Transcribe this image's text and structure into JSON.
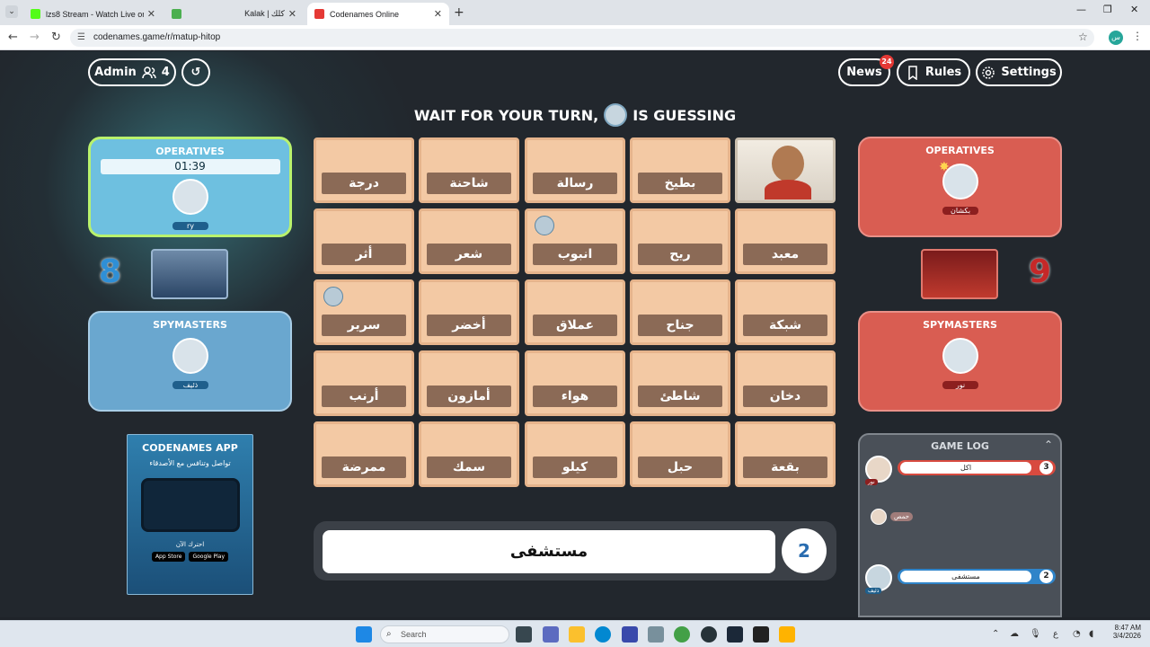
{
  "browser": {
    "tabs": [
      {
        "title": "lzs8 Stream - Watch Live on Kic",
        "favicon_color": "#53fc18"
      },
      {
        "title": "Kalak | كلك",
        "favicon_color": "#4caf50"
      },
      {
        "title": "Codenames Online",
        "favicon_color": "#e53935"
      }
    ],
    "url": "codenames.game/r/matup-hitop",
    "profile_initial": "س"
  },
  "header": {
    "admin_label": "Admin",
    "players_count": "4",
    "news_label": "News",
    "news_badge": "24",
    "rules_label": "Rules",
    "settings_label": "Settings"
  },
  "status": {
    "prefix": "WAIT FOR YOUR TURN,",
    "suffix": "IS GUESSING"
  },
  "blue_team": {
    "operatives_title": "OPERATIVES",
    "timer": "01:39",
    "operative_name": "ry",
    "score": "8",
    "spymasters_title": "SPYMASTERS",
    "spymaster_name": "ذئيف"
  },
  "red_team": {
    "operatives_title": "OPERATIVES",
    "operative_name": "بكشان",
    "score": "9",
    "spymasters_title": "SPYMASTERS",
    "spymaster_name": "نور"
  },
  "app_promo": {
    "title": "CODENAMES APP",
    "tagline": "تواصل وتنافس مع الأصدقاء",
    "cta": "احترك الآن",
    "app_store": "App Store",
    "google_play": "Google Play"
  },
  "cards": [
    "درجة",
    "شاحنة",
    "رسالة",
    "بطيخ",
    "",
    "أثر",
    "شعر",
    "انبوب",
    "ريح",
    "معبد",
    "سرير",
    "أخضر",
    "عملاق",
    "جناح",
    "شبكة",
    "أرنب",
    "أمازون",
    "هواء",
    "شاطئ",
    "دخان",
    "ممرضة",
    "سمك",
    "كيلو",
    "حبل",
    "بقعة"
  ],
  "clue": {
    "word": "مستشفى",
    "number": "2"
  },
  "game_log": {
    "title": "GAME LOG",
    "entries": [
      {
        "word": "اكل",
        "number": "3",
        "team": "red",
        "player": "نور"
      },
      {
        "word": "مستشفى",
        "number": "2",
        "team": "blue",
        "player": "ذئيف"
      }
    ],
    "guess": "حمص"
  },
  "taskbar": {
    "search_placeholder": "Search",
    "time": "8:47 AM",
    "date": "3/4/2026"
  }
}
